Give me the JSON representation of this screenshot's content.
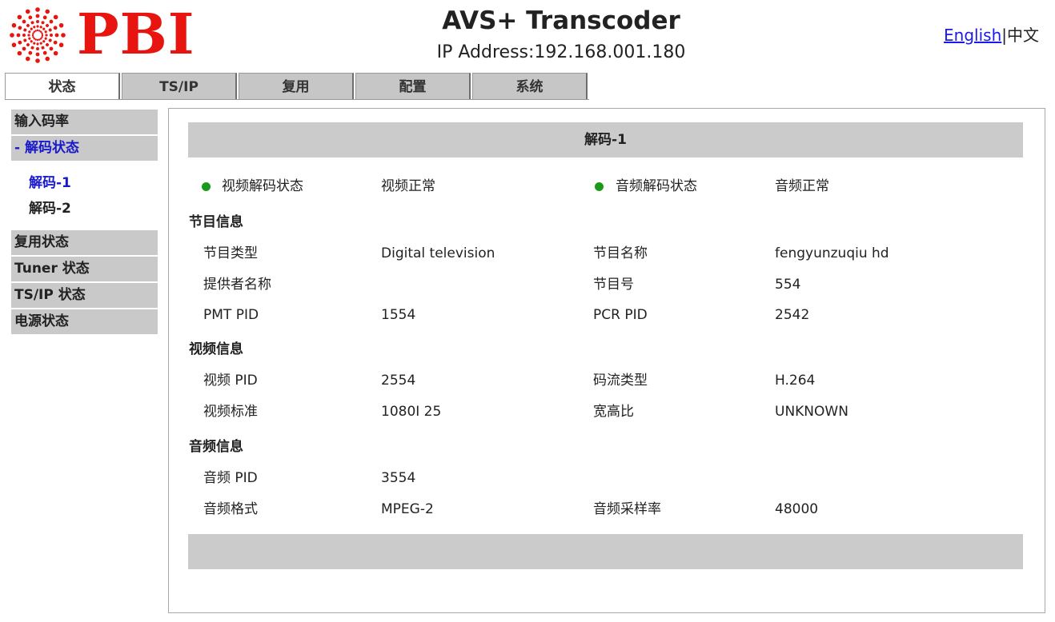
{
  "header": {
    "logo_text": "PBI",
    "title": "AVS+ Transcoder",
    "ip_label": "IP Address:",
    "ip_value": "192.168.001.180",
    "lang_english": "English",
    "lang_sep": "|",
    "lang_chinese": "中文"
  },
  "tabs": [
    {
      "label": "状态",
      "active": true
    },
    {
      "label": "TS/IP"
    },
    {
      "label": "复用"
    },
    {
      "label": "配置"
    },
    {
      "label": "系统"
    }
  ],
  "sidebar": {
    "input_rate": "输入码率",
    "decode_status": "- 解码状态",
    "sub": [
      "解码-1",
      "解码-2"
    ],
    "mux_status": "复用状态",
    "tuner_status": "Tuner 状态",
    "tsip_status": "TS/IP 状态",
    "power_status": "电源状态"
  },
  "panel": {
    "title": "解码-1",
    "status": {
      "video_label": "视频解码状态",
      "video_value": "视频正常",
      "audio_label": "音频解码状态",
      "audio_value": "音频正常",
      "ok_color": "#1a9a1a"
    },
    "program_section": "节目信息",
    "program_type_label": "节目类型",
    "program_type_value": "Digital television",
    "program_name_label": "节目名称",
    "program_name_value": "fengyunzuqiu hd",
    "provider_label": "提供者名称",
    "provider_value": "",
    "program_number_label": "节目号",
    "program_number_value": "554",
    "pmt_label": "PMT PID",
    "pmt_value": "1554",
    "pcr_label": "PCR PID",
    "pcr_value": "2542",
    "video_section": "视频信息",
    "video_pid_label": "视频 PID",
    "video_pid_value": "2554",
    "stream_type_label": "码流类型",
    "stream_type_value": "H.264",
    "video_std_label": "视频标准",
    "video_std_value": "1080I 25",
    "aspect_label": "宽高比",
    "aspect_value": "UNKNOWN",
    "audio_section": "音频信息",
    "audio_pid_label": "音频 PID",
    "audio_pid_value": "3554",
    "audio_format_label": "音频格式",
    "audio_format_value": "MPEG-2",
    "sample_rate_label": "音频采样率",
    "sample_rate_value": "48000"
  }
}
